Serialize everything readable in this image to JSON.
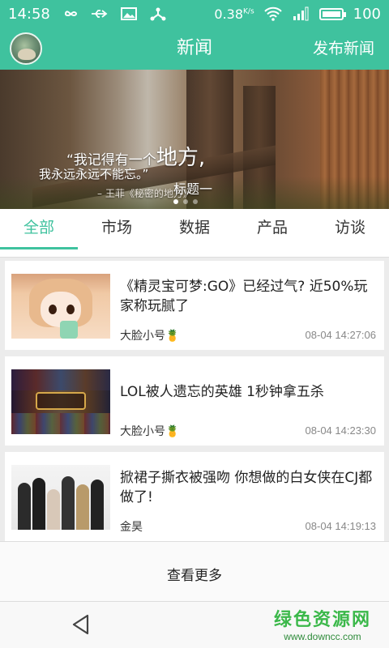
{
  "status_bar": {
    "time": "14:58",
    "net_speed": "0.38",
    "net_unit": "K/s",
    "battery_level": "100",
    "battery_fill": 1.0
  },
  "header": {
    "title": "新闻",
    "publish": "发布新闻"
  },
  "banner": {
    "quote_line1_a": "“我记得有一个",
    "quote_line1_b": "地方,",
    "quote_line2": "我永远永远不能忘。”",
    "quote_line3": "– 王菲《秘密的地方》",
    "title": "标题一",
    "active_dot": 0,
    "dot_count": 3
  },
  "tabs": [
    {
      "label": "全部",
      "active": true
    },
    {
      "label": "市场",
      "active": false
    },
    {
      "label": "数据",
      "active": false
    },
    {
      "label": "产品",
      "active": false
    },
    {
      "label": "访谈",
      "active": false
    }
  ],
  "news": [
    {
      "title": "《精灵宝可梦:GO》已经过气? 近50%玩家称玩腻了",
      "author": "大脸小号🍍",
      "time": "08-04 14:27:06",
      "thumb": "anime-girl-image"
    },
    {
      "title": "LOL被人遗忘的英雄 1秒钟拿五杀",
      "author": "大脸小号🍍",
      "time": "08-04 14:23:30",
      "thumb": "lol-heroes-image"
    },
    {
      "title": "掀裙子撕衣被强吻 你想做的白女侠在CJ都做了!",
      "author": "金昊",
      "time": "08-04 14:19:13",
      "thumb": "cosplay-group-image"
    }
  ],
  "load_more": "查看更多",
  "watermark": {
    "big": "绿色资源网",
    "small": "www.downcc.com"
  },
  "colors": {
    "accent": "#3fc29e"
  }
}
